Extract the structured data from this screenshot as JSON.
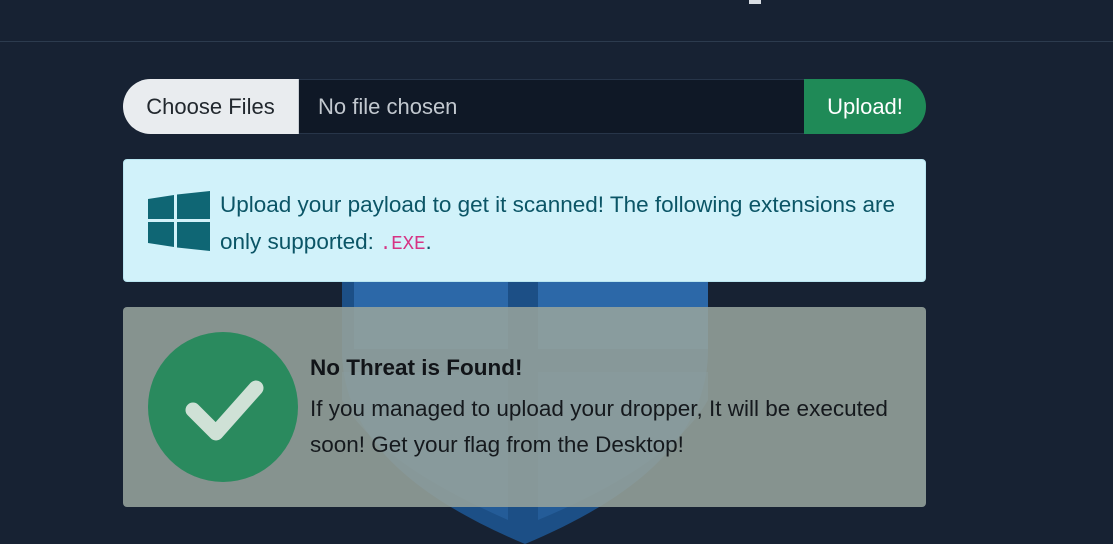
{
  "upload": {
    "choose_label": "Choose Files",
    "file_status": "No file chosen",
    "upload_label": "Upload!"
  },
  "info": {
    "message": "Upload your payload to get it scanned! The following extensions are only supported:",
    "extension": ".EXE",
    "trailing": "."
  },
  "result": {
    "title": "No Threat is Found!",
    "message": "If you managed to upload your dropper, It will be executed soon! Get your flag from the Desktop!"
  },
  "icons": {
    "info_icon": "windows-logo-icon",
    "result_icon": "check-circle-icon"
  },
  "colors": {
    "background": "#172233",
    "upload_button": "#1f8a57",
    "info_alert": "#d1f2fa",
    "extension_code": "#d63384",
    "success_circle": "#2a8a5e"
  }
}
